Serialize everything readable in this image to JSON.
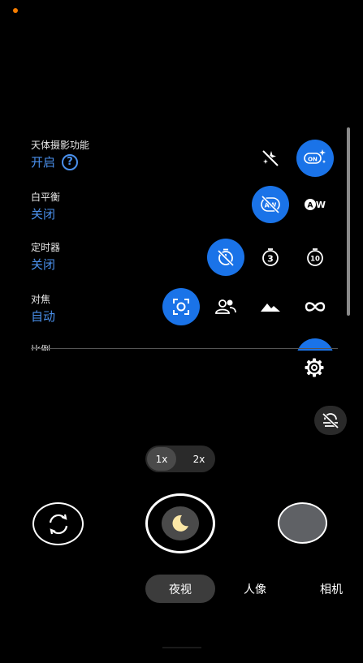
{
  "colors": {
    "accent": "#1a73e8",
    "accent_text": "#4a90ec",
    "status_dot": "#f57c00",
    "chip_bg": "#2a2a2a",
    "zoom_selected": "#4a4a4a",
    "mode_selected": "#3c3c3c",
    "thumbnail": "#5f6165",
    "shutter_inner": "#4a4a4a",
    "moon": "#fbe7a6",
    "scrollbar": "#8a8a8a"
  },
  "settings": {
    "astro": {
      "label": "天体摄影功能",
      "value": "开启",
      "help_icon": "help-circle-icon",
      "options": [
        {
          "icon": "stars-off-icon",
          "selected": false
        },
        {
          "icon": "stars-on-icon",
          "text": "ON",
          "selected": true
        }
      ]
    },
    "white_balance": {
      "label": "白平衡",
      "value": "关闭",
      "options": [
        {
          "icon": "auto-wb-off-icon",
          "selected": true
        },
        {
          "icon": "auto-wb-icon",
          "text": "AW",
          "selected": false
        }
      ]
    },
    "timer": {
      "label": "定时器",
      "value": "关闭",
      "options": [
        {
          "icon": "timer-off-icon",
          "selected": true
        },
        {
          "icon": "timer-3-icon",
          "text": "3",
          "selected": false
        },
        {
          "icon": "timer-10-icon",
          "text": "10",
          "selected": false
        }
      ]
    },
    "focus": {
      "label": "对焦",
      "value": "自动",
      "options": [
        {
          "icon": "focus-auto-icon",
          "selected": true
        },
        {
          "icon": "focus-people-icon",
          "selected": false
        },
        {
          "icon": "focus-landscape-icon",
          "selected": false
        },
        {
          "icon": "focus-infinity-icon",
          "selected": false
        }
      ]
    },
    "ratio": {
      "label": "比例"
    }
  },
  "zoom": {
    "options": [
      "1x",
      "2x"
    ],
    "selected_index": 0
  },
  "modes": [
    "夜视",
    "人像",
    "相机"
  ],
  "selected_mode_index": 0
}
